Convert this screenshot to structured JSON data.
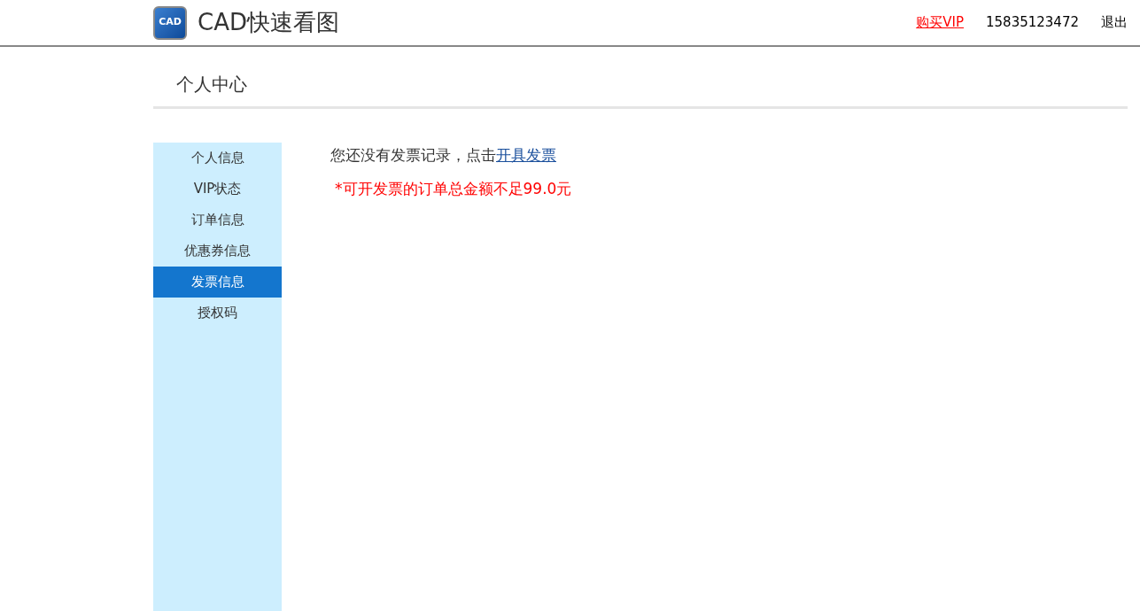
{
  "header": {
    "logo_mark": "CAD",
    "app_name": "CAD快速看图",
    "nav": [
      {
        "kind": "vip",
        "label": "购买VIP"
      },
      {
        "kind": "text",
        "label": "15835123472"
      },
      {
        "kind": "text",
        "label": "退出"
      }
    ]
  },
  "page_title": "个人中心",
  "sidebar": {
    "items": [
      {
        "label": "个人信息",
        "selected": false
      },
      {
        "label": "VIP状态",
        "selected": false
      },
      {
        "label": "订单信息",
        "selected": false
      },
      {
        "label": "优惠券信息",
        "selected": false
      },
      {
        "label": "发票信息",
        "selected": true
      },
      {
        "label": "授权码",
        "selected": false
      }
    ]
  },
  "content": {
    "message": "您还没有发票记录，点击",
    "message_link": "开具发票",
    "notice": "*可开发票的订单总金额不足99.0元"
  }
}
